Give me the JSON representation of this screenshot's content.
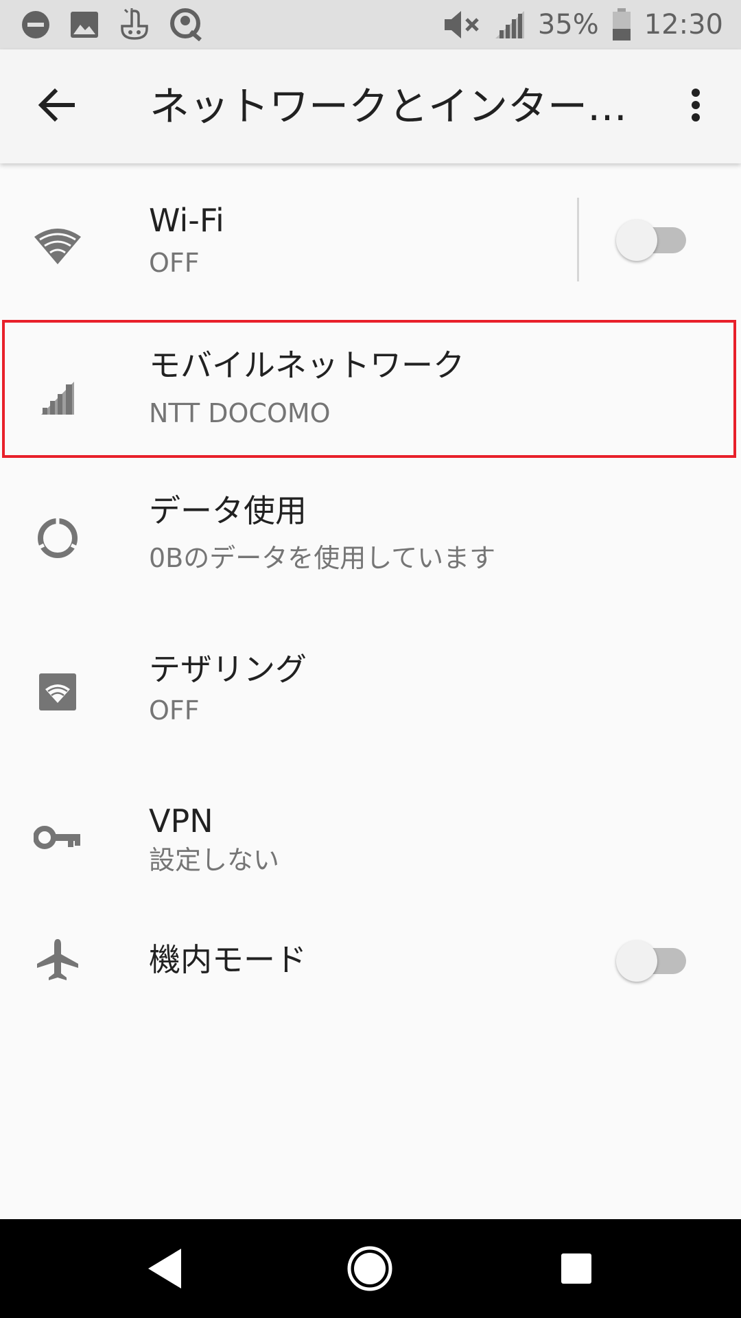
{
  "status_bar": {
    "battery_percent": "35%",
    "time": "12:30",
    "icons_left": [
      "do-not-disturb-icon",
      "image-icon",
      "app-notification-icon",
      "sync-icon"
    ],
    "icons_right": [
      "mute-icon",
      "signal-icon",
      "battery-icon"
    ]
  },
  "app_bar": {
    "title": "ネットワークとインター…",
    "back_icon": "arrow-left-icon",
    "more_icon": "more-vert-icon"
  },
  "list": {
    "items": [
      {
        "title": "Wi-Fi",
        "subtitle": "OFF",
        "icon": "wifi-icon",
        "toggle": false
      },
      {
        "title": "モバイルネットワーク",
        "subtitle": "NTT DOCOMO",
        "icon": "cellular-signal-icon"
      },
      {
        "title": "データ使用",
        "subtitle": "0Bのデータを使用しています",
        "icon": "data-usage-icon"
      },
      {
        "title": "テザリング",
        "subtitle": "OFF",
        "icon": "hotspot-icon"
      },
      {
        "title": "VPN",
        "subtitle": "設定しない",
        "icon": "vpn-key-icon"
      },
      {
        "title": "機内モード",
        "icon": "airplane-icon",
        "toggle": false
      }
    ]
  },
  "colors": {
    "highlight": "#e8202a",
    "icon_gray": "#757575",
    "status_bar_bg": "#e0e0e0",
    "nav_bar_bg": "#000000"
  },
  "nav_bar": {
    "icons": [
      "nav-back-icon",
      "nav-home-icon",
      "nav-recents-icon"
    ]
  }
}
